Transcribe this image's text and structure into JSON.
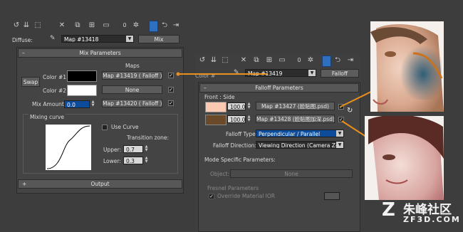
{
  "toolbar_icons_1": [
    "pick-material-icon",
    "put-to-scene-icon",
    "assign-material-icon",
    "reset-icon",
    "copy-material-icon",
    "make-unique-icon",
    "put-to-library-icon",
    "material-id-icon",
    "show-map-icon"
  ],
  "panel1": {
    "diffuse_label": "Diffuse:",
    "map_name": "Map #13418",
    "map_type": "Mix",
    "rollout_title": "Mix Parameters",
    "maps_heading": "Maps",
    "swap_label": "Swap",
    "color1_label": "Color #1",
    "color1_swatch": "#000000",
    "color1_map": "Map #13419  ( Falloff )",
    "color2_label": "Color #2",
    "color2_swatch": "#ffffff",
    "color2_map": "None",
    "mix_amount_label": "Mix Amount:",
    "mix_amount_value": "0.0",
    "mix_map": "Map #13420  ( Falloff )",
    "mixing_curve_label": "Mixing curve",
    "use_curve_label": "Use Curve",
    "transition_zone_label": "Transition zone:",
    "upper_label": "Upper:",
    "upper_value": "0.7",
    "lower_label": "Lower:",
    "lower_value": "0.3",
    "output_label": "Output"
  },
  "panel2": {
    "color_label_partial": "Color #",
    "map_name": "Map #13419",
    "map_type": "Falloff",
    "rollout_title": "Falloff Parameters",
    "front_side_label": "Front : Side",
    "row1_swatch": "#fbcab0",
    "row1_value": "100.0",
    "row1_map": "Map #13427 (脸贴图.psd)",
    "row2_swatch": "#6a4a28",
    "row2_value": "100.0",
    "row2_map": "Map #13428 (脸贴图加深.psd)",
    "falloff_type_label": "Falloff Type:",
    "falloff_type_value": "Perpendicular / Parallel",
    "falloff_direction_label": "Falloff Direction:",
    "falloff_direction_value": "Viewing Direction (Camera Z-Axis)",
    "mode_specific_label": "Mode Specific Parameters:",
    "object_label": "Object:",
    "object_value": "None",
    "fresnel_label": "Fresnel Parameters",
    "override_label": "Override Material IOR"
  },
  "watermark": {
    "text_cn": "朱峰社区",
    "text_url": "ZF3D.COM"
  },
  "colors": {
    "connector": "#e8901e",
    "accent_blue": "#0c4c9a"
  }
}
